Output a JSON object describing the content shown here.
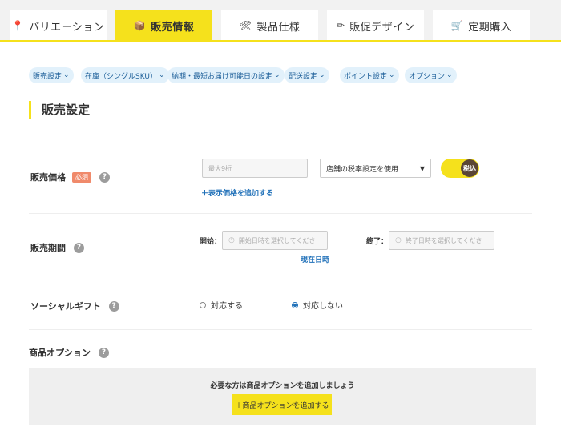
{
  "tabs": [
    {
      "label": "バリエーション",
      "icon": "pin-icon",
      "glyph": "📍"
    },
    {
      "label": "販売情報",
      "icon": "box-icon",
      "glyph": "📦"
    },
    {
      "label": "製品仕様",
      "icon": "tools-icon",
      "glyph": "🛠"
    },
    {
      "label": "販促デザイン",
      "icon": "pencil-icon",
      "glyph": "✏"
    },
    {
      "label": "定期購入",
      "icon": "cart-icon",
      "glyph": "🛒"
    }
  ],
  "subnav": [
    "販売設定",
    "在庫（シングルSKU）",
    "納期・最短お届け可能日の設定",
    "配送設定",
    "ポイント設定",
    "オプション"
  ],
  "section_title": "販売設定",
  "price": {
    "label": "販売価格",
    "required": "必須",
    "placeholder": "最大9桁",
    "tax_select": "店舗の税率設定を使用",
    "tax_toggle": "税込",
    "add_link": "＋表示価格を追加する"
  },
  "period": {
    "label": "販売期間",
    "start_label": "開始：",
    "start_placeholder": "開始日時を選択してくださ",
    "end_label": "終了：",
    "end_placeholder": "終了日時を選択してくださ",
    "now_link": "現在日時"
  },
  "gift": {
    "label": "ソーシャルギフト",
    "options": [
      "対応する",
      "対応しない"
    ],
    "selected": "対応しない"
  },
  "product_option": {
    "label": "商品オプション",
    "message": "必要な方は商品オプションを追加しましょう",
    "button": "＋商品オプションを追加する"
  },
  "colors": {
    "accent": "#f5e11c",
    "link": "#1e6fb8",
    "pill_bg": "#e2f1fb"
  }
}
